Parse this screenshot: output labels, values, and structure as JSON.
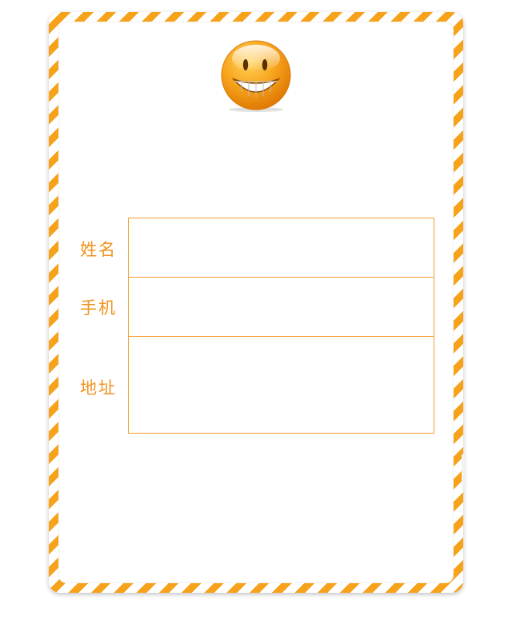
{
  "form": {
    "fields": [
      {
        "label": "姓名",
        "value": "",
        "placeholder": ""
      },
      {
        "label": "手机",
        "value": "",
        "placeholder": ""
      },
      {
        "label": "地址",
        "value": "",
        "placeholder": ""
      }
    ]
  },
  "icons": {
    "avatar": "smiley-face-icon"
  },
  "colors": {
    "accent": "#f7a21b",
    "label": "#f0931f",
    "border": "#f0a030"
  }
}
